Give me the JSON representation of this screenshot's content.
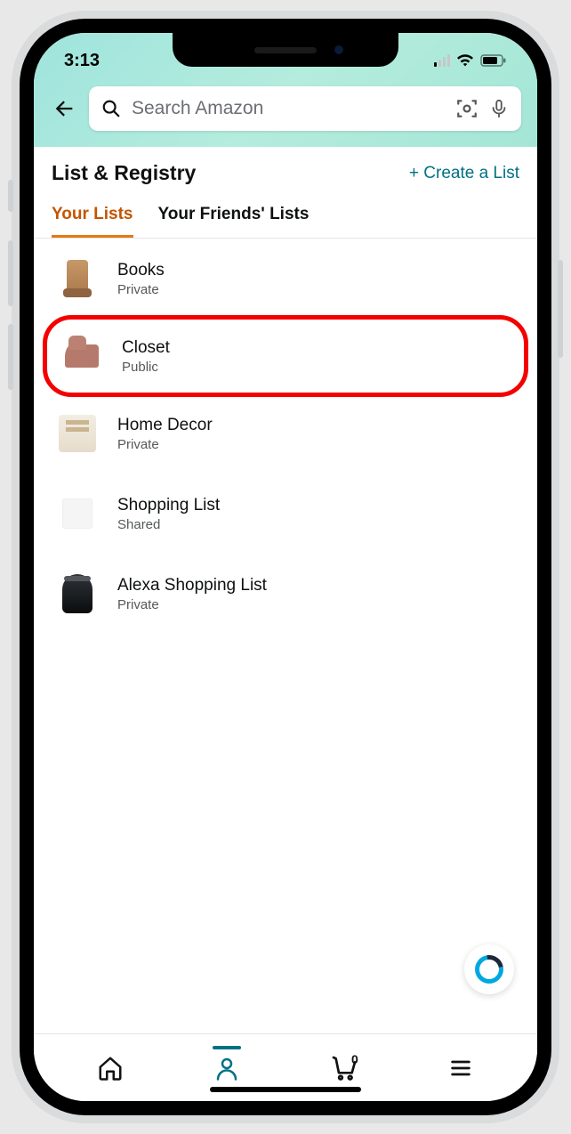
{
  "status": {
    "time": "3:13"
  },
  "search": {
    "placeholder": "Search Amazon"
  },
  "header": {
    "title": "List & Registry",
    "create_label": "+ Create a List"
  },
  "tabs": [
    {
      "label": "Your Lists",
      "active": true
    },
    {
      "label": "Your Friends' Lists",
      "active": false
    }
  ],
  "lists": [
    {
      "name": "Books",
      "visibility": "Private",
      "thumb": "boot",
      "highlighted": false
    },
    {
      "name": "Closet",
      "visibility": "Public",
      "thumb": "ankle",
      "highlighted": true
    },
    {
      "name": "Home Decor",
      "visibility": "Private",
      "thumb": "decor",
      "highlighted": false
    },
    {
      "name": "Shopping List",
      "visibility": "Shared",
      "thumb": "blank",
      "highlighted": false
    },
    {
      "name": "Alexa Shopping List",
      "visibility": "Private",
      "thumb": "echo",
      "highlighted": false
    }
  ],
  "cart": {
    "count": "0"
  }
}
